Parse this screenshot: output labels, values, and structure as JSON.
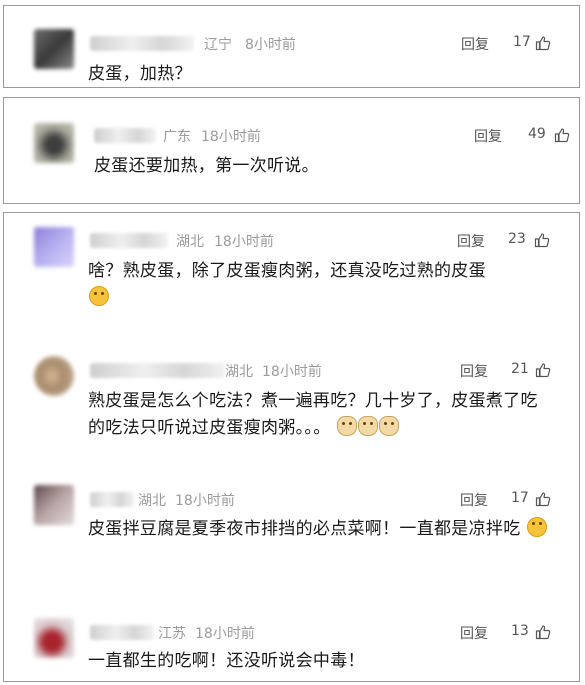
{
  "comments": [
    {
      "region": "辽宁",
      "time": "8小时前",
      "reply": "回复",
      "likes": "17",
      "text": "皮蛋，加热？",
      "emoji": ""
    },
    {
      "region": "广东",
      "time": "18小时前",
      "reply": "回复",
      "likes": "49",
      "text": "皮蛋还要加热，第一次听说。",
      "emoji": ""
    },
    {
      "region": "湖北",
      "time": "18小时前",
      "reply": "回复",
      "likes": "23",
      "text": "啥？熟皮蛋，除了皮蛋瘦肉粥，还真没吃过熟的皮蛋",
      "emoji": "laughing-cry-emoji"
    },
    {
      "region": "湖北",
      "time": "18小时前",
      "reply": "回复",
      "likes": "21",
      "text": "熟皮蛋是怎么个吃法？煮一遍再吃？几十岁了，皮蛋煮了吃的吃法只听说过皮蛋瘦肉粥。。。",
      "emoji": "doge-emoji"
    },
    {
      "region": "湖北",
      "time": "18小时前",
      "reply": "回复",
      "likes": "17",
      "text": "皮蛋拌豆腐是夏季夜市排挡的必点菜啊！一直都是凉拌吃",
      "emoji": "grin-emoji"
    },
    {
      "region": "江苏",
      "time": "18小时前",
      "reply": "回复",
      "likes": "13",
      "text": "一直都生的吃啊！还没听说会中毒！",
      "emoji": ""
    }
  ]
}
